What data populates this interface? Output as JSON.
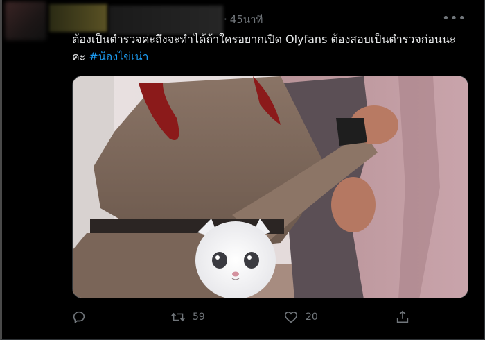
{
  "tweet": {
    "time_separator": "·",
    "time": "45นาที",
    "more": "•••",
    "text_main": "ต้องเป็นตำรวจค่ะถึงจะทำได้ถ้าใครอยากเปิด Olyfans ต้องสอบเป็นตำรวจก่อนนะคะ",
    "hashtag": "#น้องไข่เน่า"
  },
  "actions": {
    "reply_count": "",
    "retweet_count": "59",
    "like_count": "20",
    "share_count": ""
  },
  "colors": {
    "background": "#000000",
    "text": "#e7e9ea",
    "muted": "#71767b",
    "accent": "#1d9bf0"
  },
  "icons": {
    "reply": "reply-icon",
    "retweet": "retweet-icon",
    "like": "heart-icon",
    "share": "share-icon",
    "more": "more-icon"
  }
}
